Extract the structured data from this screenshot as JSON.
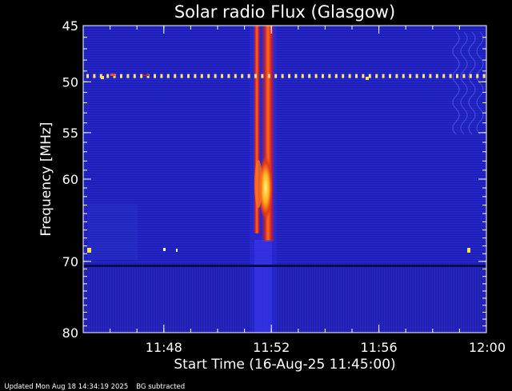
{
  "chart_data": {
    "type": "heatmap",
    "title": "Solar radio Flux (Glasgow)",
    "xlabel": "Start Time (16-Aug-25 11:45:00)",
    "ylabel": "Frequency [MHz]",
    "x_range": [
      "11:45:00",
      "12:00:00"
    ],
    "y_range_mhz": [
      45,
      80
    ],
    "y_scale": "log",
    "y_ticks": [
      45,
      50,
      55,
      60,
      70,
      80
    ],
    "x_ticks": [
      "11:48",
      "11:52",
      "11:56",
      "12:00"
    ],
    "colormap": "blue-red-yellow",
    "colors": {
      "background_low": "#1a1ab8",
      "burst_mid": "#d82020",
      "burst_high": "#ffe24a"
    },
    "features": [
      {
        "name": "burst",
        "time_start": "11:51:10",
        "time_end": "11:52:10",
        "freq_mhz": [
          45,
          80
        ],
        "peak_freq_mhz": [
          60,
          67
        ]
      },
      {
        "name": "interference-band",
        "freq_mhz": 49.5,
        "time_range": [
          "11:45:00",
          "12:00:00"
        ]
      },
      {
        "name": "interference-band",
        "freq_mhz": 72.5,
        "time_range": [
          "11:45:00",
          "12:00:00"
        ]
      }
    ]
  },
  "footer": {
    "updated": "Updated Mon Aug 18 14:34:19 2025",
    "note": "BG subtracted"
  }
}
